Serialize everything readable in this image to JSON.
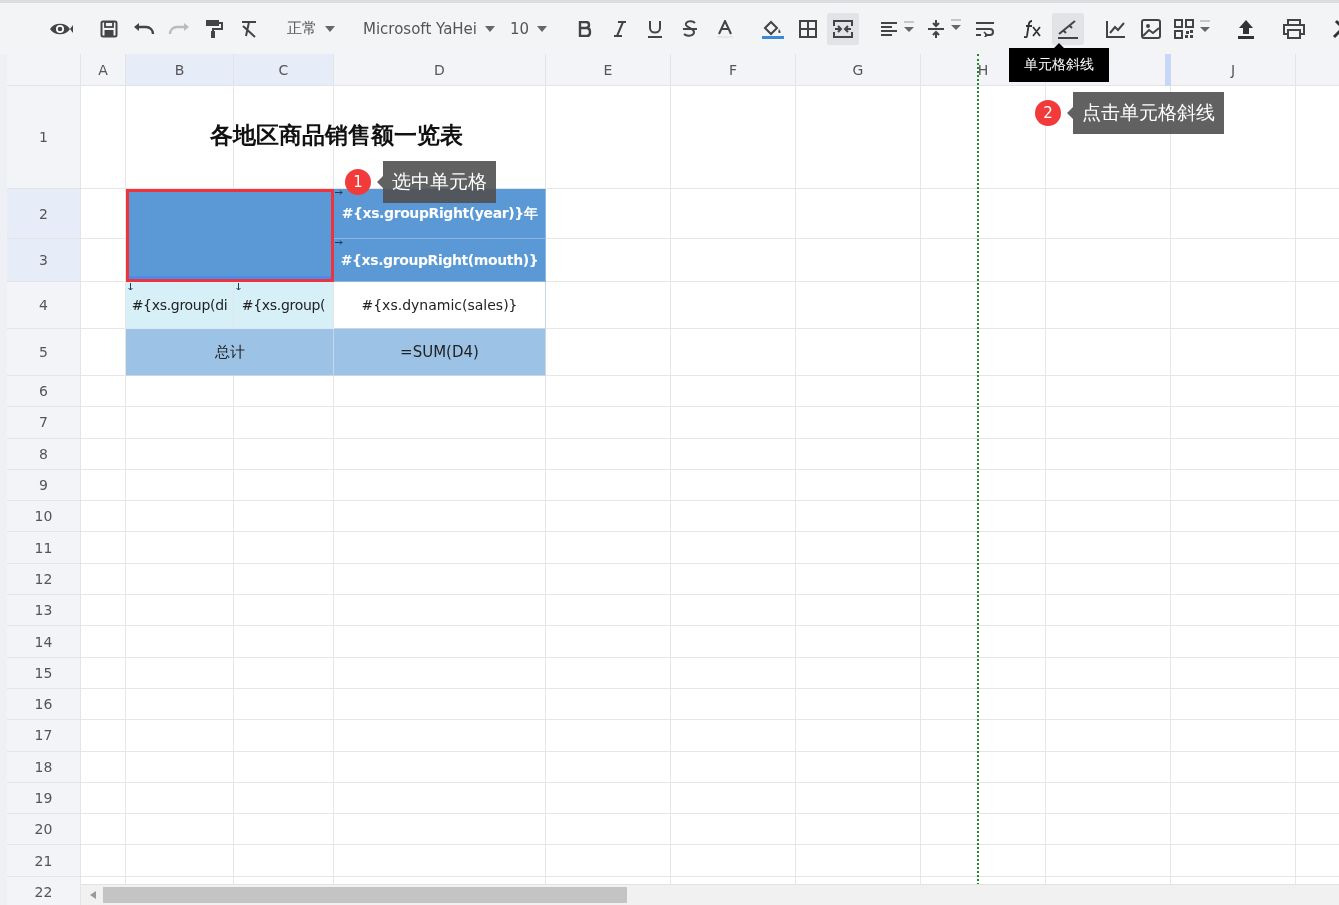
{
  "toolbar": {
    "style_select": "正常",
    "font_select": "Microsoft YaHei",
    "size_select": "10",
    "redo_disabled": true,
    "merge_cells_on": true,
    "cell_diagonal_on": true
  },
  "tooltip": "单元格斜线",
  "columns": [
    {
      "label": "A",
      "selected": false
    },
    {
      "label": "B",
      "selected": true
    },
    {
      "label": "C",
      "selected": true
    },
    {
      "label": "D",
      "selected": false
    },
    {
      "label": "E",
      "selected": false
    },
    {
      "label": "F",
      "selected": false
    },
    {
      "label": "G",
      "selected": false
    },
    {
      "label": "H",
      "selected": false
    },
    {
      "selected": false
    },
    {
      "label": "J",
      "selected": false
    }
  ],
  "rows": [
    {
      "label": "1",
      "selected": false
    },
    {
      "label": "2",
      "selected": true
    },
    {
      "label": "3",
      "selected": true
    },
    {
      "label": "4",
      "selected": false
    },
    {
      "label": "5",
      "selected": false
    },
    {
      "label": "6",
      "selected": false
    },
    {
      "label": "7",
      "selected": false
    },
    {
      "label": "8",
      "selected": false
    },
    {
      "label": "9",
      "selected": false
    },
    {
      "label": "10",
      "selected": false
    },
    {
      "label": "11",
      "selected": false
    },
    {
      "label": "12",
      "selected": false
    },
    {
      "label": "13",
      "selected": false
    },
    {
      "label": "14",
      "selected": false
    },
    {
      "label": "15",
      "selected": false
    },
    {
      "label": "16",
      "selected": false
    },
    {
      "label": "17",
      "selected": false
    },
    {
      "label": "18",
      "selected": false
    },
    {
      "label": "19",
      "selected": false
    },
    {
      "label": "20",
      "selected": false
    },
    {
      "label": "21",
      "selected": false
    },
    {
      "label": "22",
      "selected": false
    }
  ],
  "sheet": {
    "title": "各地区商品销售额一览表",
    "cells": [
      {
        "kind": "corner",
        "selected": true
      },
      {
        "kind": "header",
        "text": "#{xs.groupRight(year)}年"
      },
      {
        "kind": "header",
        "text": "#{xs.groupRight(mouth)}"
      },
      {
        "kind": "group",
        "text": "#{xs.group(di"
      },
      {
        "kind": "group",
        "text": "#{xs.group("
      },
      {
        "kind": "data",
        "text": "#{xs.dynamic(sales)}"
      },
      {
        "kind": "total",
        "text": "总计"
      },
      {
        "kind": "total",
        "text": "=SUM(D4)"
      }
    ]
  },
  "callouts": [
    {
      "number": "1",
      "text": "选中单元格"
    },
    {
      "number": "2",
      "text": "点击单元格斜线"
    }
  ]
}
